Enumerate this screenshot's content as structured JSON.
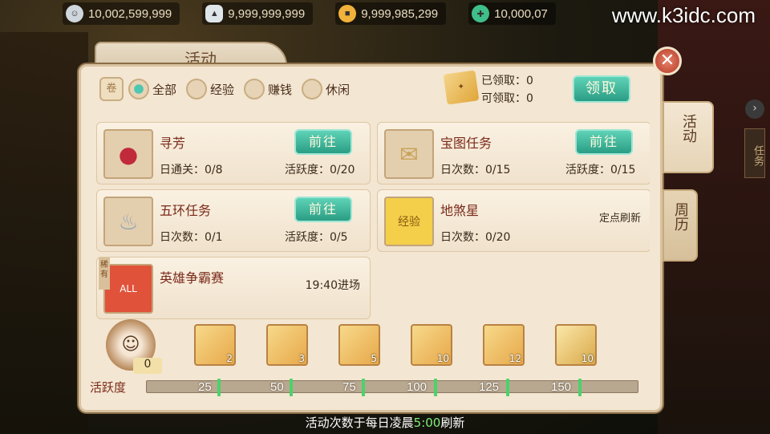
{
  "topbar": {
    "currencies": [
      {
        "icon": "silver-coin-icon",
        "value": "10,002,599,999"
      },
      {
        "icon": "silver-ingot-icon",
        "value": "9,999,999,999"
      },
      {
        "icon": "gold-coin-icon",
        "value": "9,999,985,299"
      },
      {
        "icon": "jade-icon",
        "value": "10,000,07"
      }
    ],
    "watermark": "www.k3idc.com"
  },
  "panel": {
    "title": "活动",
    "close": "✕",
    "filters": [
      "全部",
      "经验",
      "赚钱",
      "休闲"
    ],
    "selected_filter": "全部",
    "claimed_label": "已领取：0",
    "claimable_label": "可领取：0",
    "claim_button": "领取"
  },
  "activities": [
    {
      "name": "寻芳",
      "button": "前往",
      "count": "日通关：0/8",
      "activity": "活跃度：0/20",
      "icon": "red-pouch-icon"
    },
    {
      "name": "宝图任务",
      "button": "前往",
      "count": "日次数：0/15",
      "activity": "活跃度：0/15",
      "icon": "treasure-map-icon"
    },
    {
      "name": "五环任务",
      "button": "前往",
      "count": "日次数：0/1",
      "activity": "活跃度：0/5",
      "icon": "silver-bowls-icon"
    },
    {
      "name": "地煞星",
      "tag": "定点刷新",
      "count": "日次数：0/20",
      "icon": "exp-gourd-icon",
      "icon_text": "经验"
    },
    {
      "name": "英雄争霸赛",
      "time": "19:40进场",
      "ribbon": "稀有",
      "icon": "gift-box-icon",
      "icon_text": "ALL"
    }
  ],
  "activity_bar": {
    "label": "活跃度",
    "current": "0",
    "milestones": [
      "25",
      "50",
      "75",
      "100",
      "125",
      "150"
    ],
    "chest_counts": [
      "2",
      "3",
      "5",
      "10",
      "12",
      "10"
    ]
  },
  "side_tabs": [
    "活动",
    "周历"
  ],
  "task_tab": "任务",
  "footer": {
    "before": "活动次数于每日凌晨",
    "time": "5:00",
    "after": "刷新"
  },
  "colors": {
    "accent_green": "#2a9d84",
    "highlight": "#7ef07a",
    "title_red": "#7a2a1a"
  }
}
